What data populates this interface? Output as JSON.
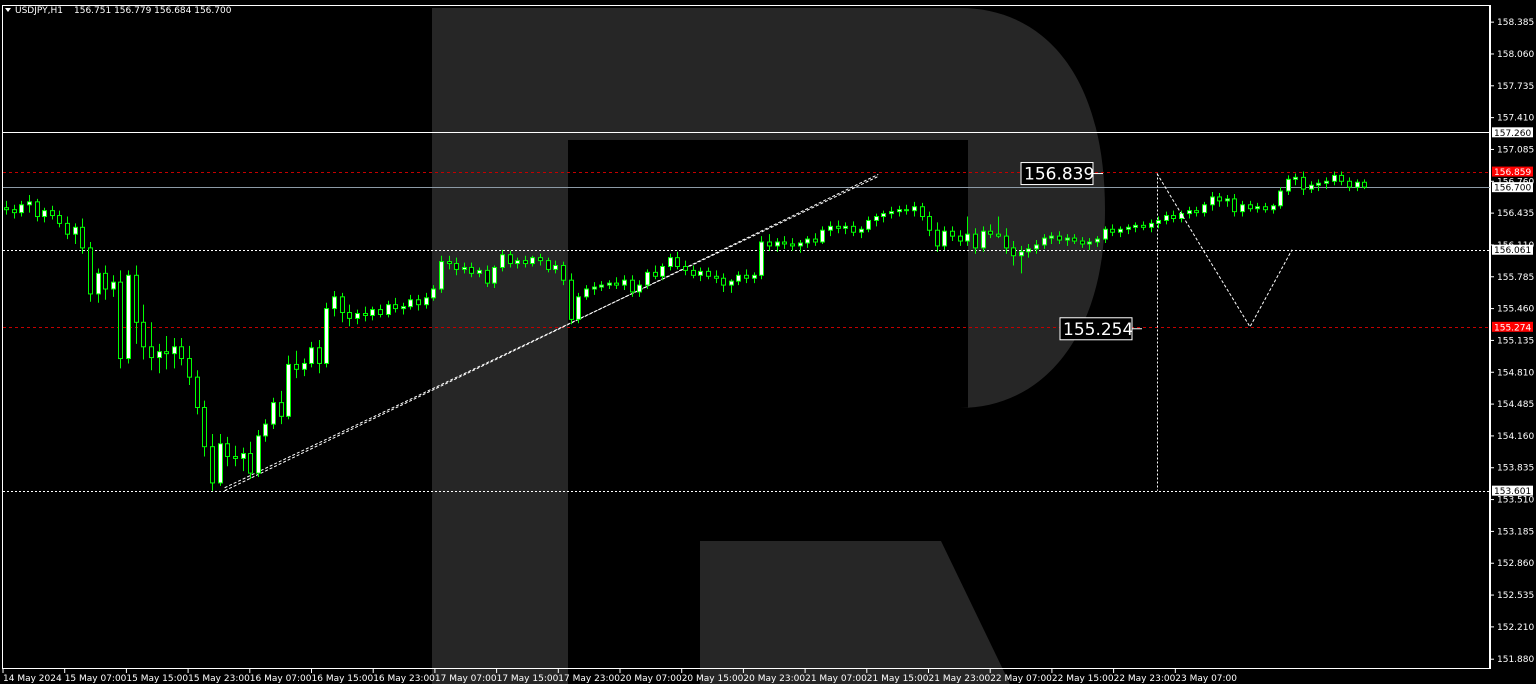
{
  "header": {
    "symbol": "USDJPY,H1",
    "ohlc": "156.751 156.779 156.684 156.700"
  },
  "colors": {
    "background": "#000000",
    "candle": "#00ff00",
    "candle_body_bull": "#ffffff",
    "axis_text": "#ffffff",
    "red_level": "#ff0000",
    "watermark": "#262626"
  },
  "chart_data": {
    "type": "candlestick",
    "title": "USDJPY,H1",
    "ylim": [
      151.78,
      158.56
    ],
    "y_ticks": [
      "158.385",
      "158.060",
      "157.735",
      "157.410",
      "157.085",
      "156.760",
      "156.435",
      "156.110",
      "155.785",
      "155.460",
      "155.135",
      "154.810",
      "154.485",
      "154.160",
      "153.835",
      "153.510",
      "153.185",
      "152.860",
      "152.535",
      "152.210",
      "151.880"
    ],
    "x_ticks": [
      "14 May 2024",
      "15 May 07:00",
      "15 May 15:00",
      "15 May 23:00",
      "16 May 07:00",
      "16 May 15:00",
      "16 May 23:00",
      "17 May 07:00",
      "17 May 15:00",
      "17 May 23:00",
      "20 May 07:00",
      "20 May 15:00",
      "20 May 23:00",
      "21 May 07:00",
      "21 May 15:00",
      "21 May 23:00",
      "22 May 07:00",
      "22 May 15:00",
      "22 May 23:00",
      "23 May 07:00"
    ],
    "price_labels": [
      {
        "text": "157.260",
        "value": 157.26,
        "style": "white"
      },
      {
        "text": "156.859",
        "value": 156.859,
        "style": "red"
      },
      {
        "text": "156.700",
        "value": 156.7,
        "style": "white"
      },
      {
        "text": "156.061",
        "value": 156.061,
        "style": "white"
      },
      {
        "text": "155.274",
        "value": 155.274,
        "style": "red"
      },
      {
        "text": "153.601",
        "value": 153.601,
        "style": "white"
      }
    ],
    "horizontal_lines": [
      {
        "value": 157.26,
        "style": "solid-white"
      },
      {
        "value": 156.859,
        "style": "dashed-red"
      },
      {
        "value": 156.7,
        "style": "solid-gray"
      },
      {
        "value": 156.061,
        "style": "dotted-white"
      },
      {
        "value": 155.274,
        "style": "dashed-red"
      },
      {
        "value": 153.601,
        "style": "dotted-white"
      }
    ],
    "callouts": [
      {
        "text": "156.839",
        "value": 156.839
      },
      {
        "text": "155.254",
        "value": 155.254
      }
    ],
    "trendline": {
      "from": [
        0,
        153.6
      ],
      "to": [
        204,
        156.83
      ]
    },
    "forecast_path": [
      [
        219,
        156.839
      ],
      [
        229,
        156.061
      ],
      [
        238,
        155.274
      ],
      [
        247,
        156.061
      ]
    ],
    "candles": [
      [
        156.49,
        156.56,
        156.42,
        156.47
      ],
      [
        156.47,
        156.52,
        156.38,
        156.44
      ],
      [
        156.44,
        156.56,
        156.4,
        156.52
      ],
      [
        156.52,
        156.62,
        156.44,
        156.55
      ],
      [
        156.55,
        156.58,
        156.35,
        156.4
      ],
      [
        156.4,
        156.49,
        156.34,
        156.46
      ],
      [
        156.46,
        156.51,
        156.37,
        156.41
      ],
      [
        156.41,
        156.46,
        156.29,
        156.33
      ],
      [
        156.33,
        156.4,
        156.17,
        156.22
      ],
      [
        156.22,
        156.33,
        156.12,
        156.29
      ],
      [
        156.29,
        156.38,
        156.02,
        156.08
      ],
      [
        156.08,
        156.14,
        155.53,
        155.61
      ],
      [
        155.61,
        155.87,
        155.52,
        155.82
      ],
      [
        155.82,
        155.9,
        155.55,
        155.66
      ],
      [
        155.66,
        155.8,
        155.58,
        155.73
      ],
      [
        155.73,
        155.85,
        154.85,
        154.95
      ],
      [
        154.95,
        155.85,
        154.9,
        155.8
      ],
      [
        155.8,
        155.9,
        155.1,
        155.32
      ],
      [
        155.32,
        155.5,
        154.94,
        155.07
      ],
      [
        155.07,
        155.32,
        154.83,
        154.96
      ],
      [
        154.96,
        155.1,
        154.8,
        155.02
      ],
      [
        155.02,
        155.18,
        154.84,
        155.0
      ],
      [
        155.0,
        155.16,
        154.85,
        155.07
      ],
      [
        155.07,
        155.16,
        154.88,
        154.95
      ],
      [
        154.95,
        155.08,
        154.68,
        154.76
      ],
      [
        154.76,
        154.83,
        154.38,
        154.45
      ],
      [
        154.45,
        154.52,
        153.95,
        154.05
      ],
      [
        154.05,
        154.18,
        153.6,
        153.68
      ],
      [
        153.68,
        154.18,
        153.65,
        154.08
      ],
      [
        154.08,
        154.15,
        153.85,
        153.95
      ],
      [
        153.95,
        154.06,
        153.85,
        153.93
      ],
      [
        153.93,
        154.04,
        153.8,
        153.98
      ],
      [
        153.98,
        154.1,
        153.72,
        153.78
      ],
      [
        153.78,
        154.22,
        153.74,
        154.16
      ],
      [
        154.16,
        154.33,
        154.1,
        154.28
      ],
      [
        154.28,
        154.55,
        154.23,
        154.5
      ],
      [
        154.5,
        154.62,
        154.28,
        154.36
      ],
      [
        154.36,
        154.98,
        154.33,
        154.89
      ],
      [
        154.89,
        155.03,
        154.75,
        154.84
      ],
      [
        154.84,
        154.95,
        154.77,
        154.9
      ],
      [
        154.9,
        155.12,
        154.86,
        155.06
      ],
      [
        155.06,
        155.14,
        154.8,
        154.9
      ],
      [
        154.9,
        155.52,
        154.86,
        155.46
      ],
      [
        155.46,
        155.64,
        155.38,
        155.58
      ],
      [
        155.58,
        155.62,
        155.32,
        155.42
      ],
      [
        155.42,
        155.5,
        155.28,
        155.36
      ],
      [
        155.36,
        155.45,
        155.3,
        155.41
      ],
      [
        155.41,
        155.48,
        155.33,
        155.39
      ],
      [
        155.39,
        155.48,
        155.34,
        155.45
      ],
      [
        155.45,
        155.5,
        155.37,
        155.4
      ],
      [
        155.4,
        155.54,
        155.37,
        155.5
      ],
      [
        155.5,
        155.57,
        155.42,
        155.46
      ],
      [
        155.46,
        155.52,
        155.4,
        155.48
      ],
      [
        155.48,
        155.6,
        155.45,
        155.55
      ],
      [
        155.55,
        155.6,
        155.44,
        155.5
      ],
      [
        155.5,
        155.62,
        155.46,
        155.57
      ],
      [
        155.57,
        155.7,
        155.54,
        155.66
      ],
      [
        155.66,
        156.0,
        155.62,
        155.94
      ],
      [
        155.94,
        156.0,
        155.86,
        155.92
      ],
      [
        155.92,
        155.98,
        155.8,
        155.86
      ],
      [
        155.86,
        155.93,
        155.82,
        155.88
      ],
      [
        155.88,
        155.93,
        155.78,
        155.82
      ],
      [
        155.82,
        155.88,
        155.78,
        155.85
      ],
      [
        155.85,
        155.9,
        155.68,
        155.72
      ],
      [
        155.72,
        155.9,
        155.67,
        155.88
      ],
      [
        155.88,
        156.06,
        155.84,
        156.01
      ],
      [
        156.01,
        156.05,
        155.88,
        155.92
      ],
      [
        155.92,
        155.98,
        155.87,
        155.95
      ],
      [
        155.95,
        156.0,
        155.88,
        155.92
      ],
      [
        155.92,
        156.0,
        155.89,
        155.98
      ],
      [
        155.98,
        156.02,
        155.9,
        155.95
      ],
      [
        155.95,
        155.98,
        155.83,
        155.86
      ],
      [
        155.86,
        155.95,
        155.82,
        155.9
      ],
      [
        155.9,
        155.94,
        155.7,
        155.75
      ],
      [
        155.75,
        155.82,
        155.3,
        155.35
      ],
      [
        155.35,
        155.62,
        155.31,
        155.58
      ],
      [
        155.58,
        155.7,
        155.55,
        155.66
      ],
      [
        155.66,
        155.73,
        155.6,
        155.68
      ],
      [
        155.68,
        155.74,
        155.64,
        155.7
      ],
      [
        155.7,
        155.75,
        155.66,
        155.72
      ],
      [
        155.72,
        155.78,
        155.66,
        155.7
      ],
      [
        155.7,
        155.8,
        155.65,
        155.75
      ],
      [
        155.75,
        155.8,
        155.58,
        155.63
      ],
      [
        155.63,
        155.75,
        155.58,
        155.7
      ],
      [
        155.7,
        155.86,
        155.66,
        155.83
      ],
      [
        155.83,
        155.9,
        155.76,
        155.79
      ],
      [
        155.79,
        155.92,
        155.75,
        155.89
      ],
      [
        155.89,
        156.02,
        155.85,
        155.98
      ],
      [
        155.98,
        156.04,
        155.86,
        155.89
      ],
      [
        155.89,
        155.95,
        155.8,
        155.85
      ],
      [
        155.85,
        155.9,
        155.77,
        155.8
      ],
      [
        155.8,
        155.88,
        155.74,
        155.84
      ],
      [
        155.84,
        155.88,
        155.76,
        155.79
      ],
      [
        155.79,
        155.85,
        155.72,
        155.77
      ],
      [
        155.77,
        155.82,
        155.63,
        155.7
      ],
      [
        155.7,
        155.76,
        155.62,
        155.74
      ],
      [
        155.74,
        155.84,
        155.7,
        155.8
      ],
      [
        155.8,
        155.86,
        155.72,
        155.77
      ],
      [
        155.77,
        155.83,
        155.72,
        155.8
      ],
      [
        155.8,
        156.2,
        155.76,
        156.14
      ],
      [
        156.14,
        156.22,
        156.05,
        156.1
      ],
      [
        156.1,
        156.18,
        156.04,
        156.14
      ],
      [
        156.14,
        156.2,
        156.07,
        156.12
      ],
      [
        156.12,
        156.18,
        156.05,
        156.1
      ],
      [
        156.1,
        156.16,
        156.03,
        156.13
      ],
      [
        156.13,
        156.2,
        156.08,
        156.17
      ],
      [
        156.17,
        156.23,
        156.1,
        156.14
      ],
      [
        156.14,
        156.3,
        156.12,
        156.26
      ],
      [
        156.26,
        156.35,
        156.2,
        156.3
      ],
      [
        156.3,
        156.36,
        156.23,
        156.28
      ],
      [
        156.28,
        156.34,
        156.22,
        156.3
      ],
      [
        156.3,
        156.35,
        156.2,
        156.24
      ],
      [
        156.24,
        156.3,
        156.18,
        156.27
      ],
      [
        156.27,
        156.4,
        156.24,
        156.36
      ],
      [
        156.36,
        156.43,
        156.3,
        156.4
      ],
      [
        156.4,
        156.46,
        156.34,
        156.43
      ],
      [
        156.43,
        156.5,
        156.38,
        156.45
      ],
      [
        156.45,
        156.51,
        156.4,
        156.47
      ],
      [
        156.47,
        156.52,
        156.42,
        156.46
      ],
      [
        156.46,
        156.55,
        156.4,
        156.5
      ],
      [
        156.5,
        156.54,
        156.36,
        156.4
      ],
      [
        156.4,
        156.45,
        156.2,
        156.26
      ],
      [
        156.26,
        156.34,
        156.04,
        156.1
      ],
      [
        156.1,
        156.3,
        156.06,
        156.25
      ],
      [
        156.25,
        156.3,
        156.15,
        156.2
      ],
      [
        156.2,
        156.26,
        156.1,
        156.15
      ],
      [
        156.15,
        156.4,
        156.1,
        156.22
      ],
      [
        156.22,
        156.28,
        156.02,
        156.08
      ],
      [
        156.08,
        156.3,
        156.04,
        156.25
      ],
      [
        156.25,
        156.32,
        156.18,
        156.22
      ],
      [
        156.22,
        156.4,
        156.18,
        156.2
      ],
      [
        156.2,
        156.28,
        156.02,
        156.08
      ],
      [
        156.08,
        156.15,
        155.9,
        156.0
      ],
      [
        156.0,
        156.1,
        155.82,
        156.04
      ],
      [
        156.04,
        156.12,
        155.98,
        156.07
      ],
      [
        156.07,
        156.16,
        156.02,
        156.11
      ],
      [
        156.11,
        156.22,
        156.07,
        156.18
      ],
      [
        156.18,
        156.24,
        156.12,
        156.2
      ],
      [
        156.2,
        156.25,
        156.12,
        156.16
      ],
      [
        156.16,
        156.22,
        156.1,
        156.18
      ],
      [
        156.18,
        156.22,
        156.12,
        156.15
      ],
      [
        156.15,
        156.19,
        156.08,
        156.12
      ],
      [
        156.12,
        156.18,
        156.06,
        156.14
      ],
      [
        156.14,
        156.2,
        156.09,
        156.17
      ],
      [
        156.17,
        156.3,
        156.13,
        156.27
      ],
      [
        156.27,
        156.32,
        156.2,
        156.24
      ],
      [
        156.24,
        156.3,
        156.19,
        156.27
      ],
      [
        156.27,
        156.32,
        156.22,
        156.29
      ],
      [
        156.29,
        156.34,
        156.24,
        156.31
      ],
      [
        156.31,
        156.35,
        156.26,
        156.29
      ],
      [
        156.29,
        156.37,
        156.24,
        156.33
      ],
      [
        156.33,
        156.4,
        156.28,
        156.36
      ],
      [
        156.36,
        156.45,
        156.32,
        156.41
      ],
      [
        156.41,
        156.46,
        156.34,
        156.38
      ],
      [
        156.38,
        156.46,
        156.34,
        156.43
      ],
      [
        156.43,
        156.5,
        156.38,
        156.46
      ],
      [
        156.46,
        156.5,
        156.4,
        156.44
      ],
      [
        156.44,
        156.55,
        156.4,
        156.52
      ],
      [
        156.52,
        156.65,
        156.46,
        156.6
      ],
      [
        156.6,
        156.64,
        156.5,
        156.56
      ],
      [
        156.56,
        156.62,
        156.5,
        156.58
      ],
      [
        156.58,
        156.63,
        156.4,
        156.45
      ],
      [
        156.45,
        156.56,
        156.4,
        156.52
      ],
      [
        156.52,
        156.56,
        156.45,
        156.48
      ],
      [
        156.48,
        156.54,
        156.44,
        156.5
      ],
      [
        156.5,
        156.54,
        156.44,
        156.47
      ],
      [
        156.47,
        156.53,
        156.43,
        156.51
      ],
      [
        156.51,
        156.7,
        156.48,
        156.66
      ],
      [
        156.66,
        156.82,
        156.62,
        156.78
      ],
      [
        156.78,
        156.84,
        156.72,
        156.8
      ],
      [
        156.8,
        156.86,
        156.62,
        156.68
      ],
      [
        156.68,
        156.76,
        156.64,
        156.72
      ],
      [
        156.72,
        156.78,
        156.66,
        156.74
      ],
      [
        156.74,
        156.8,
        156.68,
        156.76
      ],
      [
        156.76,
        156.86,
        156.72,
        156.82
      ],
      [
        156.82,
        156.86,
        156.72,
        156.76
      ],
      [
        156.76,
        156.8,
        156.66,
        156.7
      ],
      [
        156.7,
        156.78,
        156.66,
        156.75
      ],
      [
        156.75,
        156.78,
        156.68,
        156.7
      ]
    ]
  }
}
